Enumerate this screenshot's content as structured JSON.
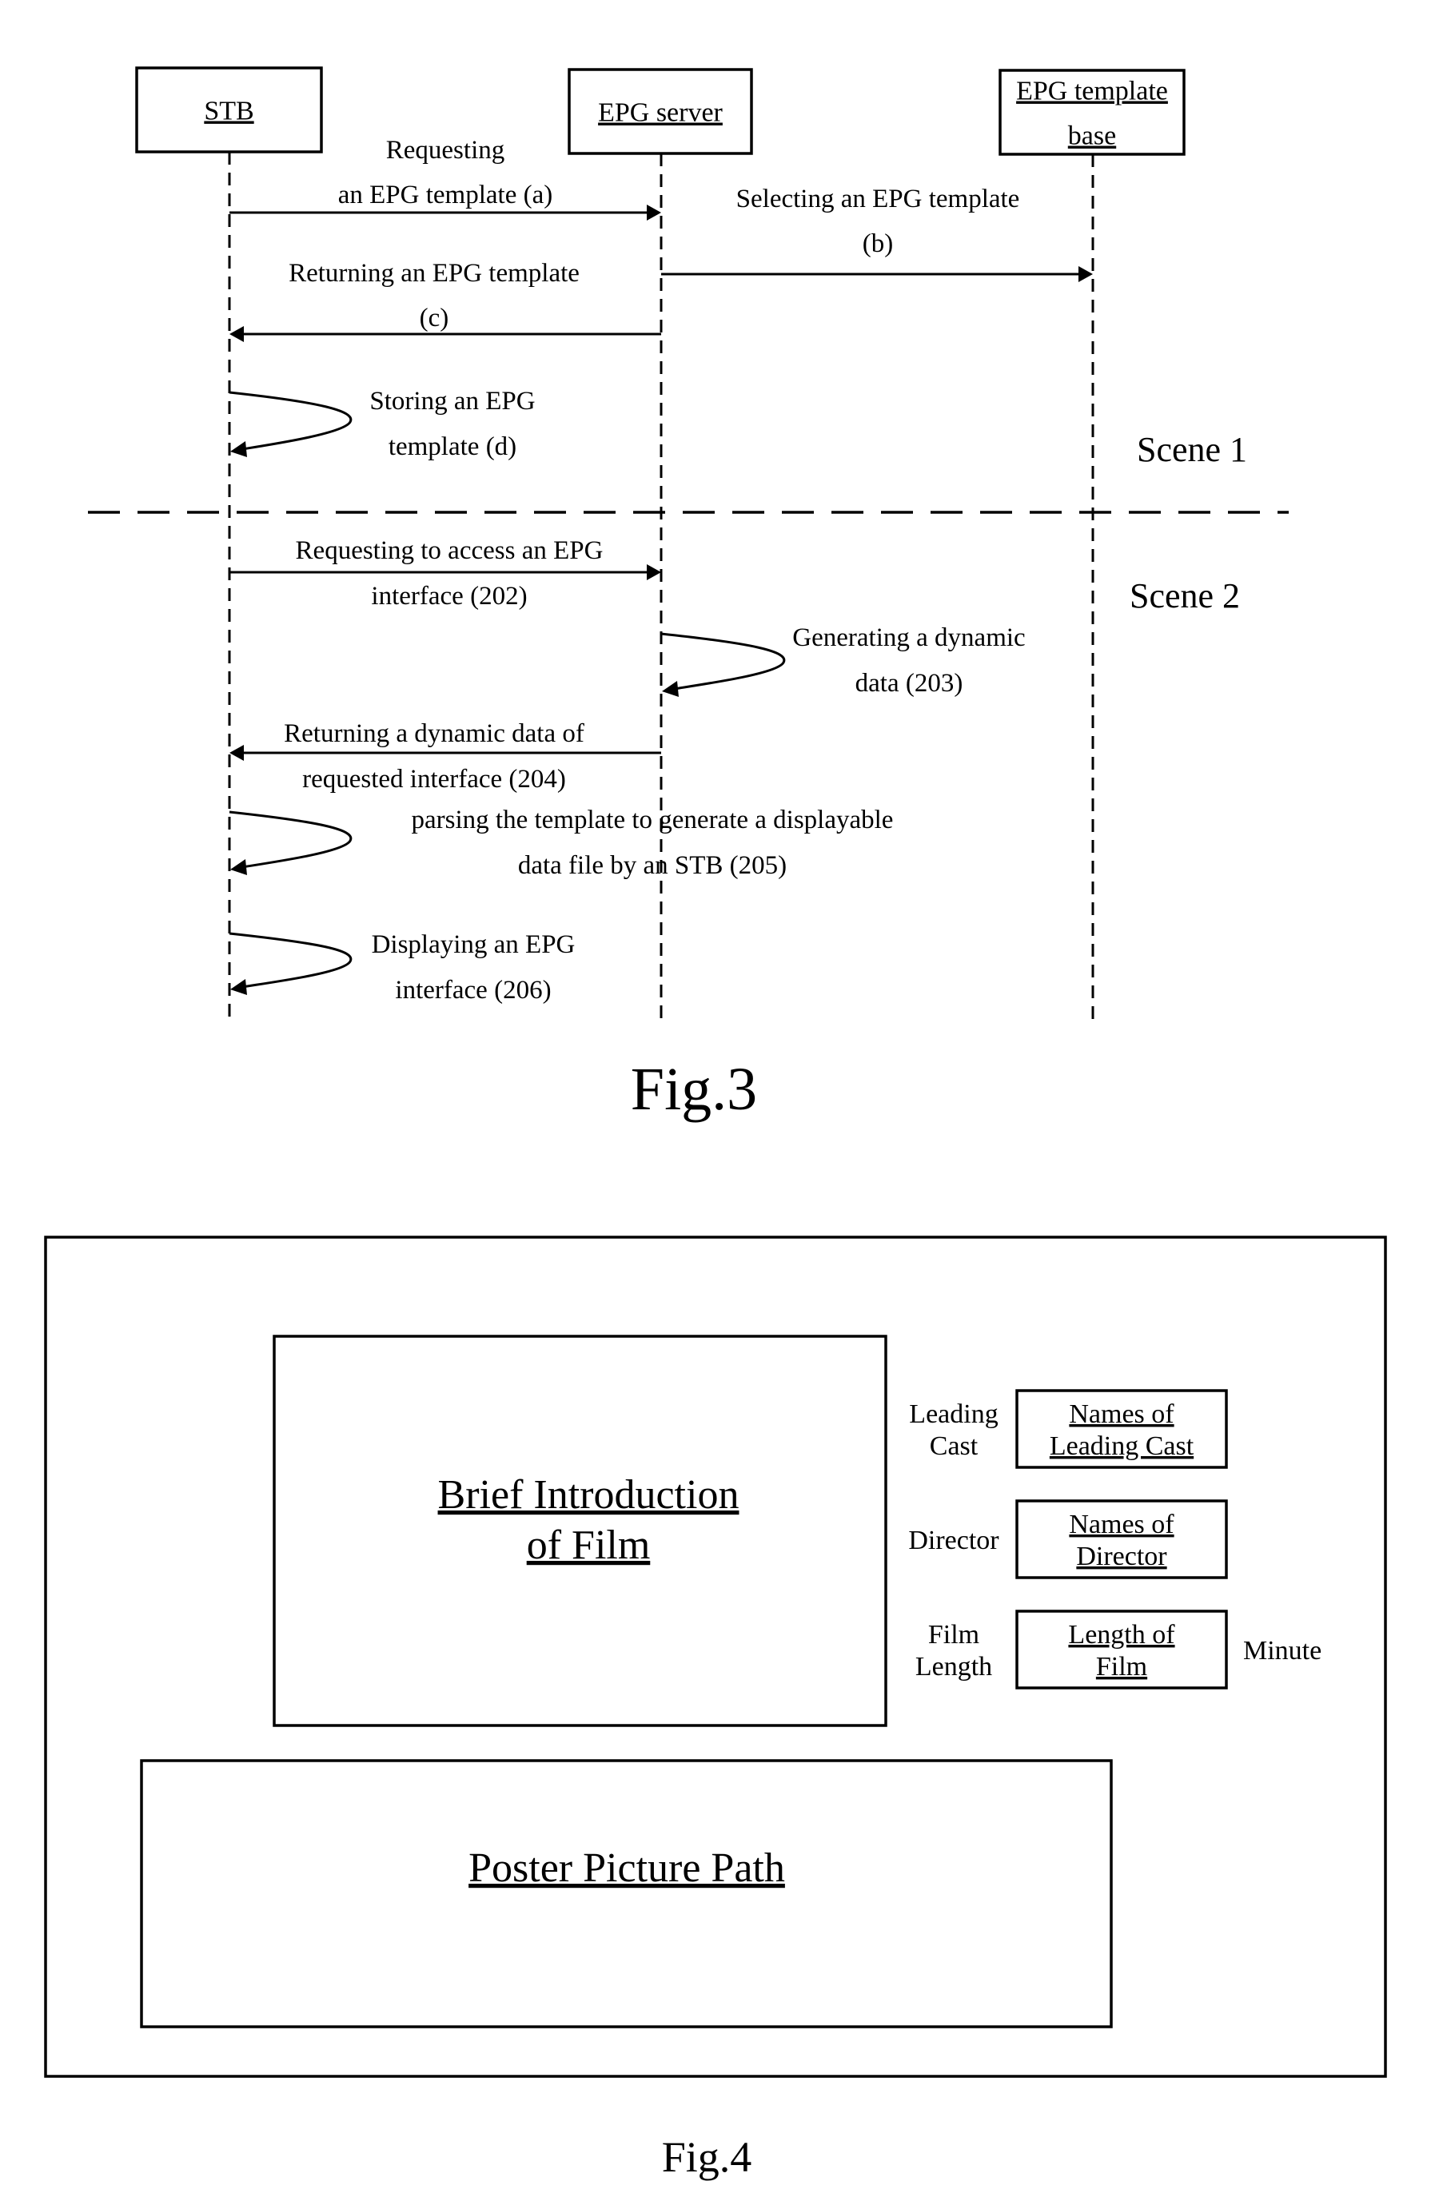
{
  "figure3": {
    "caption": "Fig.3",
    "actors": [
      {
        "id": "stb",
        "label_lines": [
          "STB"
        ]
      },
      {
        "id": "server",
        "label_lines": [
          "EPG server"
        ]
      },
      {
        "id": "base",
        "label_lines": [
          "EPG template",
          "base"
        ]
      }
    ],
    "messages": [
      {
        "id": "a",
        "from": "stb",
        "to": "server",
        "label_lines": [
          "Requesting",
          "an EPG template (a)"
        ]
      },
      {
        "id": "b",
        "from": "server",
        "to": "base",
        "label_lines": [
          "Selecting an EPG template",
          "(b)"
        ]
      },
      {
        "id": "c",
        "from": "server",
        "to": "stb",
        "label_lines": [
          "Returning an EPG template",
          "(c)"
        ]
      },
      {
        "id": "d",
        "from": "stb",
        "to": "stb",
        "label_lines": [
          "Storing an EPG",
          "template (d)"
        ]
      },
      {
        "id": "202",
        "from": "stb",
        "to": "server",
        "label_lines": [
          "Requesting to access an EPG",
          "interface (202)"
        ]
      },
      {
        "id": "203",
        "from": "server",
        "to": "server",
        "label_lines": [
          "Generating a dynamic",
          "data (203)"
        ]
      },
      {
        "id": "204",
        "from": "server",
        "to": "stb",
        "label_lines": [
          "Returning a dynamic data of",
          "requested interface (204)"
        ]
      },
      {
        "id": "205",
        "from": "stb",
        "to": "stb",
        "label_lines": [
          "parsing the template to generate a displayable",
          "data file by an STB (205)"
        ]
      },
      {
        "id": "206",
        "from": "stb",
        "to": "stb",
        "label_lines": [
          "Displaying an EPG",
          "interface (206)"
        ]
      }
    ],
    "scenes": [
      "Scene 1",
      "Scene 2"
    ]
  },
  "figure4": {
    "caption": "Fig.4",
    "intro_lines": [
      "Brief Introduction",
      "of Film"
    ],
    "poster_label": "Poster Picture Path",
    "fields": [
      {
        "label_lines": [
          "Leading",
          "Cast"
        ],
        "value_lines": [
          "Names of",
          "Leading Cast"
        ],
        "unit": ""
      },
      {
        "label_lines": [
          "Director"
        ],
        "value_lines": [
          "Names of",
          "Director"
        ],
        "unit": ""
      },
      {
        "label_lines": [
          "Film",
          "Length"
        ],
        "value_lines": [
          "Length of",
          "Film"
        ],
        "unit": "Minute"
      }
    ]
  }
}
